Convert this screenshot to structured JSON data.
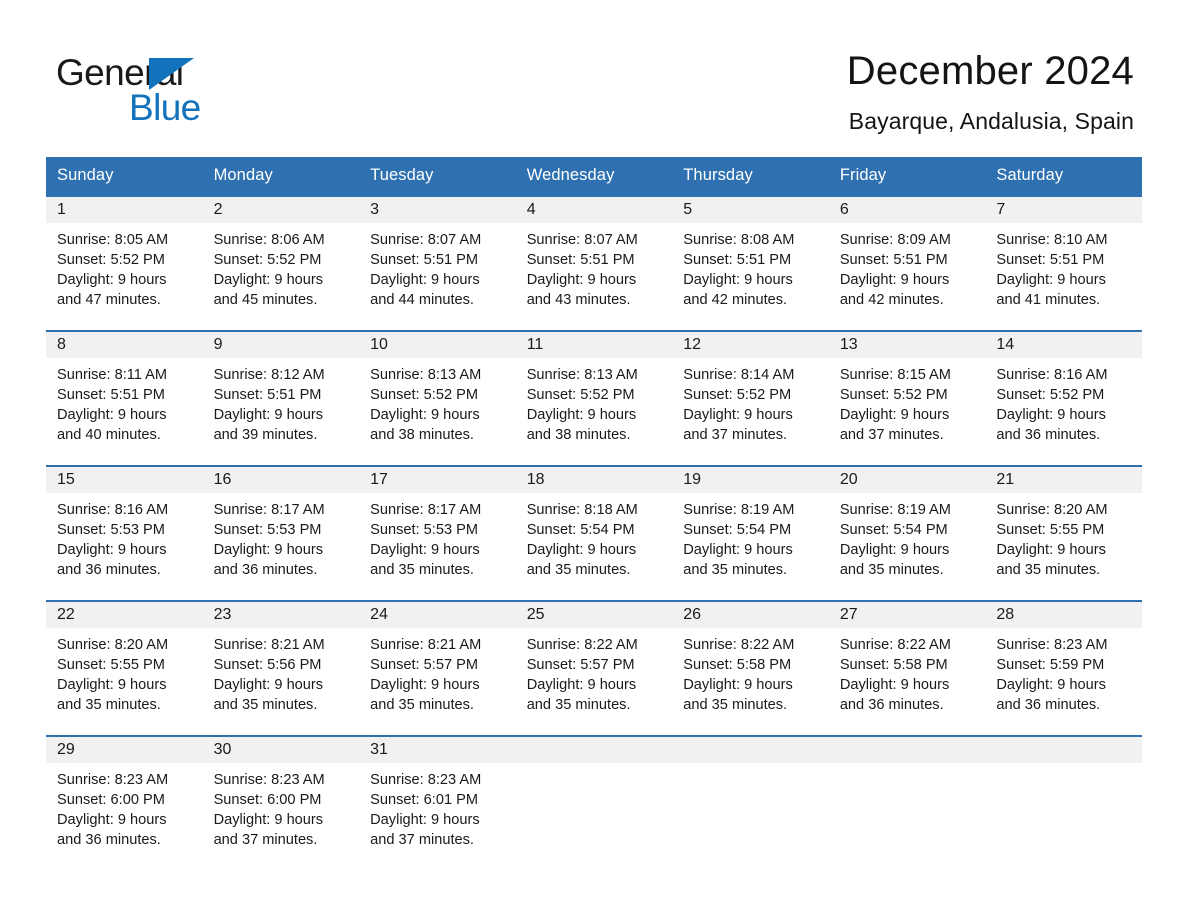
{
  "brand": {
    "name_part1": "General",
    "name_part2": "Blue",
    "logo_icon": "triangle-logo-icon",
    "accent_color": "#1272bb"
  },
  "header": {
    "title": "December 2024",
    "subtitle": "Bayarque, Andalusia, Spain"
  },
  "theme": {
    "header_blue": "#2e70b0",
    "date_strip_gray": "#f1f1f1",
    "text": "#1a1a1a"
  },
  "calendar": {
    "weekdays": [
      "Sunday",
      "Monday",
      "Tuesday",
      "Wednesday",
      "Thursday",
      "Friday",
      "Saturday"
    ],
    "weeks": [
      [
        {
          "date": "1",
          "sunrise": "Sunrise: 8:05 AM",
          "sunset": "Sunset: 5:52 PM",
          "daylight_line1": "Daylight: 9 hours",
          "daylight_line2": "and 47 minutes."
        },
        {
          "date": "2",
          "sunrise": "Sunrise: 8:06 AM",
          "sunset": "Sunset: 5:52 PM",
          "daylight_line1": "Daylight: 9 hours",
          "daylight_line2": "and 45 minutes."
        },
        {
          "date": "3",
          "sunrise": "Sunrise: 8:07 AM",
          "sunset": "Sunset: 5:51 PM",
          "daylight_line1": "Daylight: 9 hours",
          "daylight_line2": "and 44 minutes."
        },
        {
          "date": "4",
          "sunrise": "Sunrise: 8:07 AM",
          "sunset": "Sunset: 5:51 PM",
          "daylight_line1": "Daylight: 9 hours",
          "daylight_line2": "and 43 minutes."
        },
        {
          "date": "5",
          "sunrise": "Sunrise: 8:08 AM",
          "sunset": "Sunset: 5:51 PM",
          "daylight_line1": "Daylight: 9 hours",
          "daylight_line2": "and 42 minutes."
        },
        {
          "date": "6",
          "sunrise": "Sunrise: 8:09 AM",
          "sunset": "Sunset: 5:51 PM",
          "daylight_line1": "Daylight: 9 hours",
          "daylight_line2": "and 42 minutes."
        },
        {
          "date": "7",
          "sunrise": "Sunrise: 8:10 AM",
          "sunset": "Sunset: 5:51 PM",
          "daylight_line1": "Daylight: 9 hours",
          "daylight_line2": "and 41 minutes."
        }
      ],
      [
        {
          "date": "8",
          "sunrise": "Sunrise: 8:11 AM",
          "sunset": "Sunset: 5:51 PM",
          "daylight_line1": "Daylight: 9 hours",
          "daylight_line2": "and 40 minutes."
        },
        {
          "date": "9",
          "sunrise": "Sunrise: 8:12 AM",
          "sunset": "Sunset: 5:51 PM",
          "daylight_line1": "Daylight: 9 hours",
          "daylight_line2": "and 39 minutes."
        },
        {
          "date": "10",
          "sunrise": "Sunrise: 8:13 AM",
          "sunset": "Sunset: 5:52 PM",
          "daylight_line1": "Daylight: 9 hours",
          "daylight_line2": "and 38 minutes."
        },
        {
          "date": "11",
          "sunrise": "Sunrise: 8:13 AM",
          "sunset": "Sunset: 5:52 PM",
          "daylight_line1": "Daylight: 9 hours",
          "daylight_line2": "and 38 minutes."
        },
        {
          "date": "12",
          "sunrise": "Sunrise: 8:14 AM",
          "sunset": "Sunset: 5:52 PM",
          "daylight_line1": "Daylight: 9 hours",
          "daylight_line2": "and 37 minutes."
        },
        {
          "date": "13",
          "sunrise": "Sunrise: 8:15 AM",
          "sunset": "Sunset: 5:52 PM",
          "daylight_line1": "Daylight: 9 hours",
          "daylight_line2": "and 37 minutes."
        },
        {
          "date": "14",
          "sunrise": "Sunrise: 8:16 AM",
          "sunset": "Sunset: 5:52 PM",
          "daylight_line1": "Daylight: 9 hours",
          "daylight_line2": "and 36 minutes."
        }
      ],
      [
        {
          "date": "15",
          "sunrise": "Sunrise: 8:16 AM",
          "sunset": "Sunset: 5:53 PM",
          "daylight_line1": "Daylight: 9 hours",
          "daylight_line2": "and 36 minutes."
        },
        {
          "date": "16",
          "sunrise": "Sunrise: 8:17 AM",
          "sunset": "Sunset: 5:53 PM",
          "daylight_line1": "Daylight: 9 hours",
          "daylight_line2": "and 36 minutes."
        },
        {
          "date": "17",
          "sunrise": "Sunrise: 8:17 AM",
          "sunset": "Sunset: 5:53 PM",
          "daylight_line1": "Daylight: 9 hours",
          "daylight_line2": "and 35 minutes."
        },
        {
          "date": "18",
          "sunrise": "Sunrise: 8:18 AM",
          "sunset": "Sunset: 5:54 PM",
          "daylight_line1": "Daylight: 9 hours",
          "daylight_line2": "and 35 minutes."
        },
        {
          "date": "19",
          "sunrise": "Sunrise: 8:19 AM",
          "sunset": "Sunset: 5:54 PM",
          "daylight_line1": "Daylight: 9 hours",
          "daylight_line2": "and 35 minutes."
        },
        {
          "date": "20",
          "sunrise": "Sunrise: 8:19 AM",
          "sunset": "Sunset: 5:54 PM",
          "daylight_line1": "Daylight: 9 hours",
          "daylight_line2": "and 35 minutes."
        },
        {
          "date": "21",
          "sunrise": "Sunrise: 8:20 AM",
          "sunset": "Sunset: 5:55 PM",
          "daylight_line1": "Daylight: 9 hours",
          "daylight_line2": "and 35 minutes."
        }
      ],
      [
        {
          "date": "22",
          "sunrise": "Sunrise: 8:20 AM",
          "sunset": "Sunset: 5:55 PM",
          "daylight_line1": "Daylight: 9 hours",
          "daylight_line2": "and 35 minutes."
        },
        {
          "date": "23",
          "sunrise": "Sunrise: 8:21 AM",
          "sunset": "Sunset: 5:56 PM",
          "daylight_line1": "Daylight: 9 hours",
          "daylight_line2": "and 35 minutes."
        },
        {
          "date": "24",
          "sunrise": "Sunrise: 8:21 AM",
          "sunset": "Sunset: 5:57 PM",
          "daylight_line1": "Daylight: 9 hours",
          "daylight_line2": "and 35 minutes."
        },
        {
          "date": "25",
          "sunrise": "Sunrise: 8:22 AM",
          "sunset": "Sunset: 5:57 PM",
          "daylight_line1": "Daylight: 9 hours",
          "daylight_line2": "and 35 minutes."
        },
        {
          "date": "26",
          "sunrise": "Sunrise: 8:22 AM",
          "sunset": "Sunset: 5:58 PM",
          "daylight_line1": "Daylight: 9 hours",
          "daylight_line2": "and 35 minutes."
        },
        {
          "date": "27",
          "sunrise": "Sunrise: 8:22 AM",
          "sunset": "Sunset: 5:58 PM",
          "daylight_line1": "Daylight: 9 hours",
          "daylight_line2": "and 36 minutes."
        },
        {
          "date": "28",
          "sunrise": "Sunrise: 8:23 AM",
          "sunset": "Sunset: 5:59 PM",
          "daylight_line1": "Daylight: 9 hours",
          "daylight_line2": "and 36 minutes."
        }
      ],
      [
        {
          "date": "29",
          "sunrise": "Sunrise: 8:23 AM",
          "sunset": "Sunset: 6:00 PM",
          "daylight_line1": "Daylight: 9 hours",
          "daylight_line2": "and 36 minutes."
        },
        {
          "date": "30",
          "sunrise": "Sunrise: 8:23 AM",
          "sunset": "Sunset: 6:00 PM",
          "daylight_line1": "Daylight: 9 hours",
          "daylight_line2": "and 37 minutes."
        },
        {
          "date": "31",
          "sunrise": "Sunrise: 8:23 AM",
          "sunset": "Sunset: 6:01 PM",
          "daylight_line1": "Daylight: 9 hours",
          "daylight_line2": "and 37 minutes."
        },
        {
          "date": "",
          "sunrise": "",
          "sunset": "",
          "daylight_line1": "",
          "daylight_line2": ""
        },
        {
          "date": "",
          "sunrise": "",
          "sunset": "",
          "daylight_line1": "",
          "daylight_line2": ""
        },
        {
          "date": "",
          "sunrise": "",
          "sunset": "",
          "daylight_line1": "",
          "daylight_line2": ""
        },
        {
          "date": "",
          "sunrise": "",
          "sunset": "",
          "daylight_line1": "",
          "daylight_line2": ""
        }
      ]
    ]
  }
}
